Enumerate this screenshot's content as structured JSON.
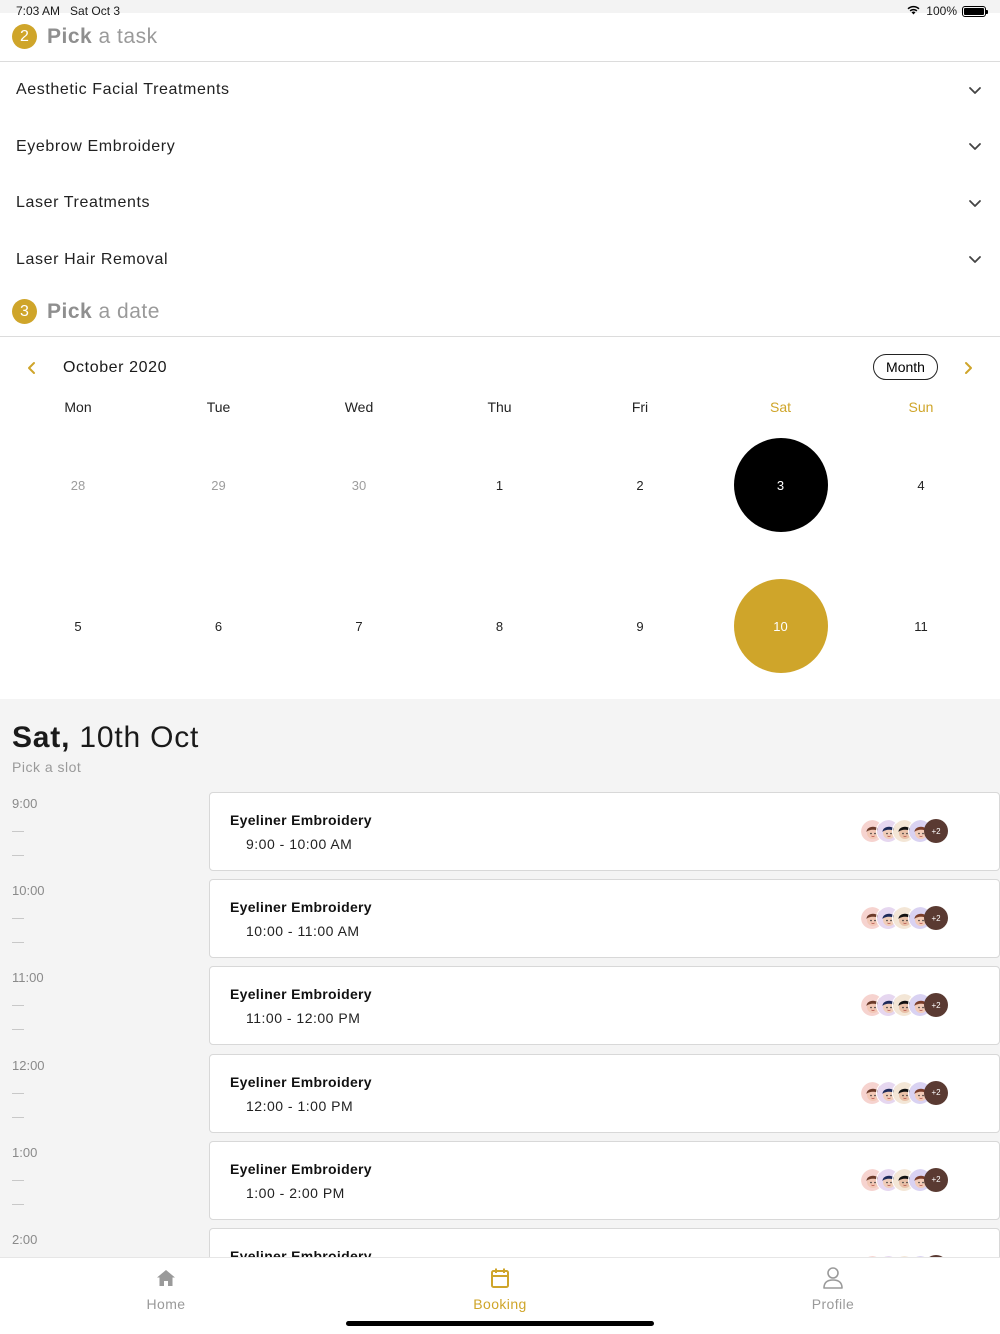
{
  "status_bar": {
    "time": "7:03 AM",
    "date": "Sat Oct 3",
    "battery": "100%"
  },
  "task_section": {
    "step": "2",
    "title_bold": "Pick",
    "title_rest": " a task"
  },
  "tasks": [
    {
      "label": "Aesthetic Facial Treatments"
    },
    {
      "label": "Eyebrow Embroidery"
    },
    {
      "label": "Laser Treatments"
    },
    {
      "label": "Laser Hair Removal"
    }
  ],
  "date_section": {
    "step": "3",
    "title_bold": "Pick",
    "title_rest": " a date"
  },
  "calendar": {
    "month_label": "October 2020",
    "view_button": "Month",
    "weekdays": [
      "Mon",
      "Tue",
      "Wed",
      "Thu",
      "Fri",
      "Sat",
      "Sun"
    ],
    "weeks": [
      [
        "28",
        "29",
        "30",
        "1",
        "2",
        "3",
        "4"
      ],
      [
        "5",
        "6",
        "7",
        "8",
        "9",
        "10",
        "11"
      ]
    ],
    "muted_days": [
      "28",
      "29",
      "30"
    ],
    "today": "3",
    "selected": "10",
    "accent_color": "#cfa52a"
  },
  "slots_section": {
    "day_name": "Sat,",
    "day_date": " 10th Oct",
    "subtitle": "Pick a slot",
    "time_labels": [
      "9:00",
      "10:00",
      "11:00",
      "12:00",
      "1:00",
      "2:00"
    ],
    "slots": [
      {
        "title": "Eyeliner Embroidery",
        "time": "9:00 - 10:00 AM",
        "more": "+2"
      },
      {
        "title": "Eyeliner Embroidery",
        "time": "10:00 - 11:00 AM",
        "more": "+2"
      },
      {
        "title": "Eyeliner Embroidery",
        "time": "11:00 - 12:00 PM",
        "more": "+2"
      },
      {
        "title": "Eyeliner Embroidery",
        "time": "12:00 - 1:00 PM",
        "more": "+2"
      },
      {
        "title": "Eyeliner Embroidery",
        "time": "1:00 - 2:00 PM",
        "more": "+2"
      },
      {
        "title": "Eyeliner Embroidery",
        "time": "",
        "more": ""
      }
    ]
  },
  "tab_bar": {
    "tabs": [
      {
        "label": "Home",
        "icon": "home-icon"
      },
      {
        "label": "Booking",
        "icon": "calendar-icon"
      },
      {
        "label": "Profile",
        "icon": "person-icon"
      }
    ],
    "active": "Booking"
  }
}
